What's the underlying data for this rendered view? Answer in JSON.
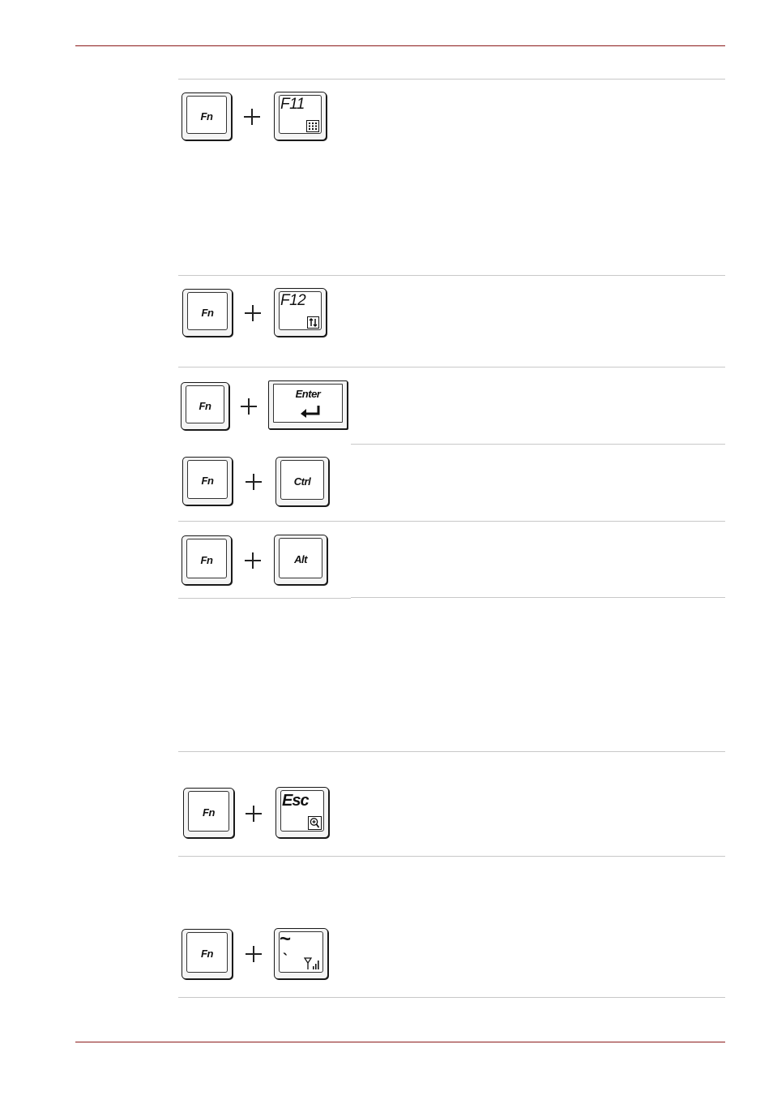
{
  "rows": [
    {
      "fn": "Fn",
      "key": "F11",
      "icon": "keypad-overlay-icon"
    },
    {
      "fn": "Fn",
      "key": "F12",
      "icon": "scroll-lock-icon"
    },
    {
      "fn": "Fn",
      "key": "Enter",
      "icon": "enter-arrow-icon"
    },
    {
      "fn": "Fn",
      "key": "Ctrl"
    },
    {
      "fn": "Fn",
      "key": "Alt"
    },
    {
      "fn": "Fn",
      "key": "Esc",
      "icon": "magnifier-zoom-icon"
    },
    {
      "fn": "Fn",
      "key_top": "~",
      "key_bottom": "`",
      "icon": "wireless-signal-icon"
    }
  ],
  "colors": {
    "page_rule": "#8b1a1a",
    "separator": "#c8c8c8"
  }
}
